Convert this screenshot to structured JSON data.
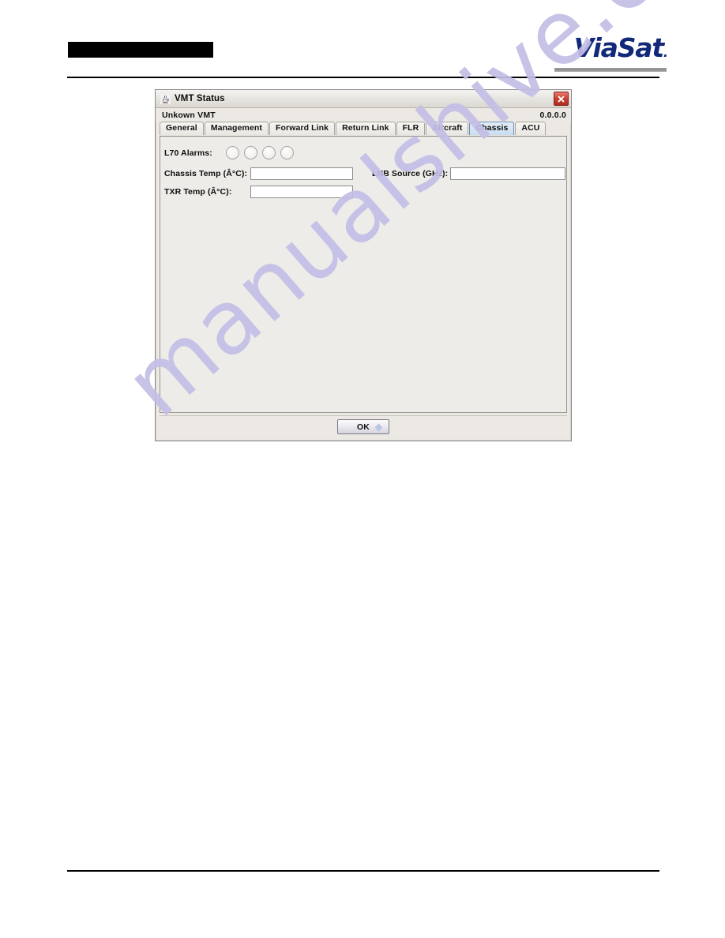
{
  "page": {
    "brand": {
      "name": "ViaSat",
      "trademark_dot": "."
    }
  },
  "watermark": {
    "text": "manualshive.com",
    "color": "#c3bee6"
  },
  "dialog": {
    "title": "VMT Status",
    "title_icon": "java-cup-icon",
    "close_icon": "close-icon",
    "subheader": {
      "device_name": "Unkown VMT",
      "ip_address": "0.0.0.0"
    },
    "tabs": [
      {
        "label": "General",
        "selected": false
      },
      {
        "label": "Management",
        "selected": false
      },
      {
        "label": "Forward Link",
        "selected": false
      },
      {
        "label": "Return Link",
        "selected": false
      },
      {
        "label": "FLR",
        "selected": false
      },
      {
        "label": "Aircraft",
        "selected": false
      },
      {
        "label": "Chassis",
        "selected": true
      },
      {
        "label": "ACU",
        "selected": false
      }
    ],
    "chassis_panel": {
      "alarms": {
        "label": "L70 Alarms:",
        "indicators": [
          {
            "name": "alarm-led-1",
            "state": "off"
          },
          {
            "name": "alarm-led-2",
            "state": "off"
          },
          {
            "name": "alarm-led-3",
            "state": "off"
          },
          {
            "name": "alarm-led-4",
            "state": "off"
          }
        ]
      },
      "fields": {
        "chassis_temp": {
          "label": "Chassis Temp (Â°C):",
          "value": ""
        },
        "txr_temp": {
          "label": "TXR Temp (Â°C):",
          "value": ""
        },
        "lnb_source": {
          "label": "LNB Source (GHz):",
          "value": ""
        }
      }
    },
    "buttons": {
      "ok": "OK"
    },
    "colors": {
      "selected_tab": "#c9ddf2",
      "close_button": "#cf4336",
      "panel_background": "#edece8"
    }
  }
}
